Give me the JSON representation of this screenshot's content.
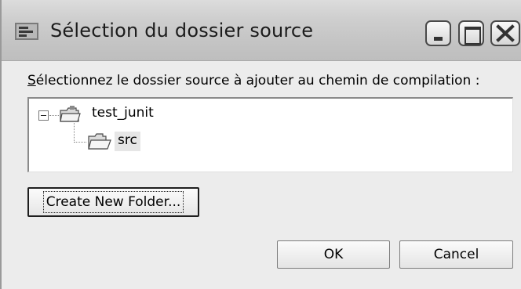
{
  "window": {
    "title": "Sélection du dossier source"
  },
  "instruction": {
    "accel_char": "S",
    "rest": "électionnez le dossier source à ajouter au chemin de  compilation :"
  },
  "tree": {
    "root": {
      "label": "test_junit",
      "icon": "project-folder-icon",
      "expanded": true
    },
    "children": [
      {
        "label": "src",
        "icon": "open-folder-icon",
        "selected": true
      }
    ]
  },
  "buttons": {
    "create_folder": "Create New Folder...",
    "ok": "OK",
    "cancel": "Cancel"
  },
  "titlebar_buttons": [
    "minimize-icon",
    "maximize-icon",
    "close-icon"
  ],
  "colors": {
    "titlebar": "#c8c8c8",
    "dialog_bg": "#ececec",
    "selection": "#e6e6e6"
  }
}
